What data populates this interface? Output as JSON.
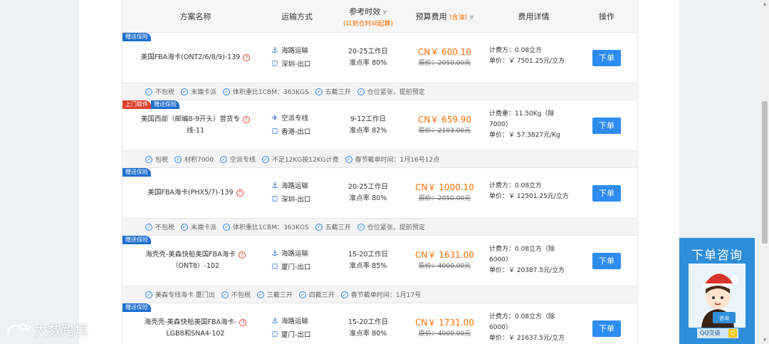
{
  "header": {
    "col_name": "方案名称",
    "col_transport": "运输方式",
    "col_time": "参考时效",
    "col_time_sub": "(以到仓时间起算)",
    "col_price": "预算费用",
    "col_price_sub": "(含油)",
    "col_detail": "费用详情",
    "col_action": "操作",
    "sort_icon": "▼"
  },
  "rows": [
    {
      "tags": [
        "赠送保险"
      ],
      "name_line1": "美国FBA海卡(ONT2/6/8/9)-139",
      "name_line2": "",
      "transport": "海路运输",
      "origin": "深圳-出口",
      "days": "20-25工作日",
      "rate": "准点率 80%",
      "price": "CN￥ 600.10",
      "orig_price": "原价：2050.00元",
      "detail1": "计费方：0.08立方",
      "detail2": "单价：￥ 7501.25元/立方",
      "detail3": "",
      "button": "下单",
      "features": [
        "不包税",
        "末端卡派",
        "体积重比1CBM：363KGS",
        "五截三开",
        "仓位紧张，提前预定"
      ]
    },
    {
      "tags": [
        "上门取件",
        "赠送保险"
      ],
      "name_line1": "美国西部（邮编8-9开头）普货专",
      "name_line2": "线-11",
      "transport": "空派专线",
      "origin": "香港-出口",
      "days": "9-12工作日",
      "rate": "准点率 82%",
      "price": "CN￥ 659.90",
      "orig_price": "原价：2103.00元",
      "detail1": "计费重：11.50Kg（除",
      "detail2": "7000）",
      "detail3": "单价：￥ 57.3827元/Kg",
      "button": "下单",
      "features": [
        "包税",
        "材积7000",
        "空派专线",
        "不足12KG按12KG计费",
        "春节截单时间：1月16号12点"
      ]
    },
    {
      "tags": [
        "赠送保险"
      ],
      "name_line1": "美国FBA海卡(PHX5/7)-139",
      "name_line2": "",
      "transport": "海路运输",
      "origin": "深圳-出口",
      "days": "20-25工作日",
      "rate": "准点率 80%",
      "price": "CN￥ 1000.10",
      "orig_price": "原价：2050.00元",
      "detail1": "计费方：0.08立方",
      "detail2": "单价：￥ 12501.25元/立方",
      "detail3": "",
      "button": "下单",
      "features": [
        "不包税",
        "末端卡派",
        "体积重比1CBM：363KGS",
        "五截三开",
        "仓位紧张，提前预定"
      ]
    },
    {
      "tags": [
        "赠送保险"
      ],
      "name_line1": "海壳壳-美森快船美国FBA海卡",
      "name_line2": "（ONT8）-102",
      "transport": "海路运输",
      "origin": "厦门-出口",
      "days": "15-20工作日",
      "rate": "准点率 85%",
      "price": "CN￥ 1631.00",
      "orig_price": "原价：4000.00元",
      "detail1": "计费方：0.08立方（除",
      "detail2": "6000）",
      "detail3": "单价：￥ 20387.5元/立方",
      "button": "下单",
      "features": [
        "美森专线海卡  厦门出",
        "不包税",
        "三截三开",
        "四截三开",
        "春节截单时间：1月17号"
      ]
    },
    {
      "tags": [
        "赠送保险"
      ],
      "name_line1": "海壳壳-美森快船美国FBA海卡-",
      "name_line2": "LGB8和SNA4-102",
      "transport": "海路运输",
      "origin": "厦门-出口",
      "days": "15-20工作日",
      "rate": "准点率 80%",
      "price": "CN￥ 1731.00",
      "orig_price": "原价：4000.00元",
      "detail1": "计费方：0.08立方（除",
      "detail2": "6000）",
      "detail3": "单价：￥ 21637.5元/立方",
      "button": "下单",
      "features": []
    }
  ],
  "consult": {
    "title": "下单咨询",
    "qq_label": "QQ交谈",
    "card_text": "咨询"
  },
  "watermark": "大数跨境",
  "icons": {
    "sea": "anchor-icon",
    "air": "airplane-icon",
    "origin": "port-icon",
    "help": "question-icon",
    "check": "check-circle-icon"
  },
  "colors": {
    "accent": "#2d8cf0",
    "price": "#ff6d00",
    "tag_blue": "#1e6fcf",
    "tag_red": "#e0412c"
  }
}
